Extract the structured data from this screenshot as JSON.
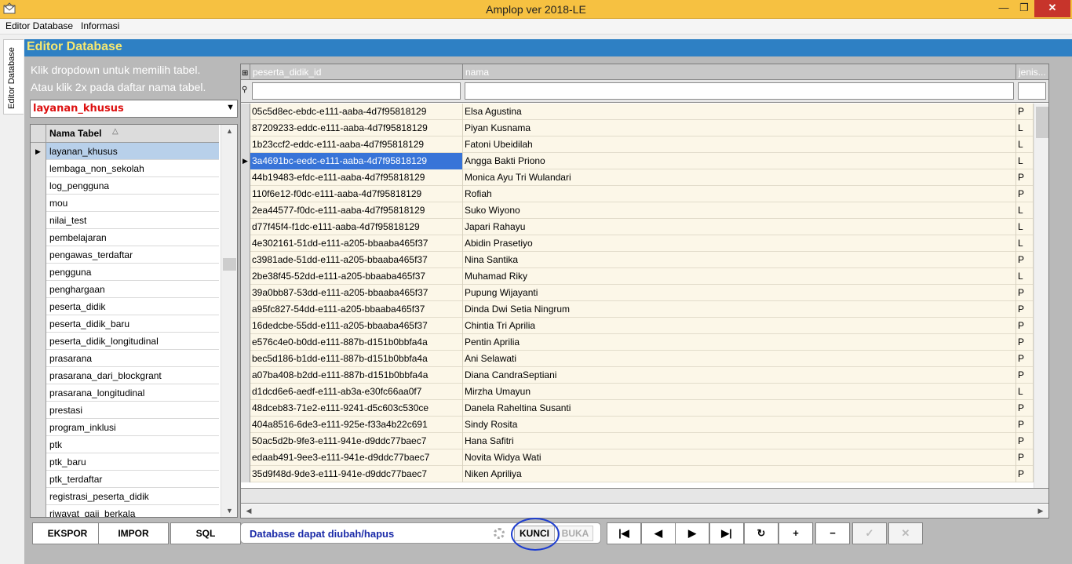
{
  "window": {
    "title": "Amplop ver 2018-LE"
  },
  "menubar": {
    "items": [
      "Editor Database",
      "Informasi"
    ]
  },
  "side_tab": {
    "label": "Editor Database"
  },
  "panel": {
    "title": "Editor Database",
    "hint_line1": "Klik dropdown untuk memilih tabel.",
    "hint_line2": "Atau klik 2x pada daftar nama tabel."
  },
  "table_select": {
    "value": "layanan_khusus"
  },
  "table_list": {
    "header": "Nama Tabel",
    "items": [
      "layanan_khusus",
      "lembaga_non_sekolah",
      "log_pengguna",
      "mou",
      "nilai_test",
      "pembelajaran",
      "pengawas_terdaftar",
      "pengguna",
      "penghargaan",
      "peserta_didik",
      "peserta_didik_baru",
      "peserta_didik_longitudinal",
      "prasarana",
      "prasarana_dari_blockgrant",
      "prasarana_longitudinal",
      "prestasi",
      "program_inklusi",
      "ptk",
      "ptk_baru",
      "ptk_terdaftar",
      "registrasi_peserta_didik",
      "riwayat_gaji_berkala"
    ],
    "selected_index": 0
  },
  "grid": {
    "columns": [
      "peserta_didik_id",
      "nama",
      "jenis..."
    ],
    "rows": [
      [
        "05c5d8ec-ebdc-e111-aaba-4d7f95818129",
        "Elsa Agustina",
        "P"
      ],
      [
        "87209233-eddc-e111-aaba-4d7f95818129",
        "Piyan Kusnama",
        "L"
      ],
      [
        "1b23ccf2-eddc-e111-aaba-4d7f95818129",
        "Fatoni Ubeidilah",
        "L"
      ],
      [
        "3a4691bc-eedc-e111-aaba-4d7f95818129",
        "Angga Bakti Priono",
        "L"
      ],
      [
        "44b19483-efdc-e111-aaba-4d7f95818129",
        "Monica Ayu Tri Wulandari",
        "P"
      ],
      [
        "110f6e12-f0dc-e111-aaba-4d7f95818129",
        "Rofiah",
        "P"
      ],
      [
        "2ea44577-f0dc-e111-aaba-4d7f95818129",
        "Suko Wiyono",
        "L"
      ],
      [
        "d77f45f4-f1dc-e111-aaba-4d7f95818129",
        "Japari Rahayu",
        "L"
      ],
      [
        "4e302161-51dd-e111-a205-bbaaba465f37",
        "Abidin Prasetiyo",
        "L"
      ],
      [
        "c3981ade-51dd-e111-a205-bbaaba465f37",
        "Nina Santika",
        "P"
      ],
      [
        "2be38f45-52dd-e111-a205-bbaaba465f37",
        "Muhamad Riky",
        "L"
      ],
      [
        "39a0bb87-53dd-e111-a205-bbaaba465f37",
        "Pupung Wijayanti",
        "P"
      ],
      [
        "a95fc827-54dd-e111-a205-bbaaba465f37",
        "Dinda Dwi Setia Ningrum",
        "P"
      ],
      [
        "16dedcbe-55dd-e111-a205-bbaaba465f37",
        "Chintia Tri Aprilia",
        "P"
      ],
      [
        "e576c4e0-b0dd-e111-887b-d151b0bbfa4a",
        "Pentin Aprilia",
        "P"
      ],
      [
        "bec5d186-b1dd-e111-887b-d151b0bbfa4a",
        "Ani Selawati",
        "P"
      ],
      [
        "a07ba408-b2dd-e111-887b-d151b0bbfa4a",
        "Diana CandraSeptiani",
        "P"
      ],
      [
        "d1dcd6e6-aedf-e111-ab3a-e30fc66aa0f7",
        "Mirzha Umayun",
        "L"
      ],
      [
        "48dceb83-71e2-e111-9241-d5c603c530ce",
        "Danela Raheltina Susanti",
        "P"
      ],
      [
        "404a8516-6de3-e111-925e-f33a4b22c691",
        "Sindy Rosita",
        "P"
      ],
      [
        "50ac5d2b-9fe3-e111-941e-d9ddc77baec7",
        "Hana Safitri",
        "P"
      ],
      [
        "edaab491-9ee3-e111-941e-d9ddc77baec7",
        "Novita Widya Wati",
        "P"
      ],
      [
        "35d9f48d-9de3-e111-941e-d9ddc77baec7",
        "Niken Apriliya",
        "P"
      ]
    ],
    "selected_row": 3
  },
  "toolbar": {
    "ekspor": "EKSPOR",
    "impor": "IMPOR",
    "sql": "SQL",
    "status_text": "Database dapat diubah/hapus",
    "kunci": "KUNCI",
    "buka": "BUKA"
  },
  "nav": {
    "first": "|◀",
    "prev": "◀",
    "next": "▶",
    "last": "▶|",
    "refresh": "↻",
    "add": "+",
    "delete": "−",
    "post": "✓",
    "cancel": "✕"
  },
  "colors": {
    "titlebar": "#f6c141",
    "panel_header": "#2e80c4",
    "panel_title": "#f7e870",
    "grid_row": "#fcf7e8",
    "selection": "#3874d8",
    "status_text": "#1a2aa8",
    "annotation_circle": "#1e3ed0"
  }
}
